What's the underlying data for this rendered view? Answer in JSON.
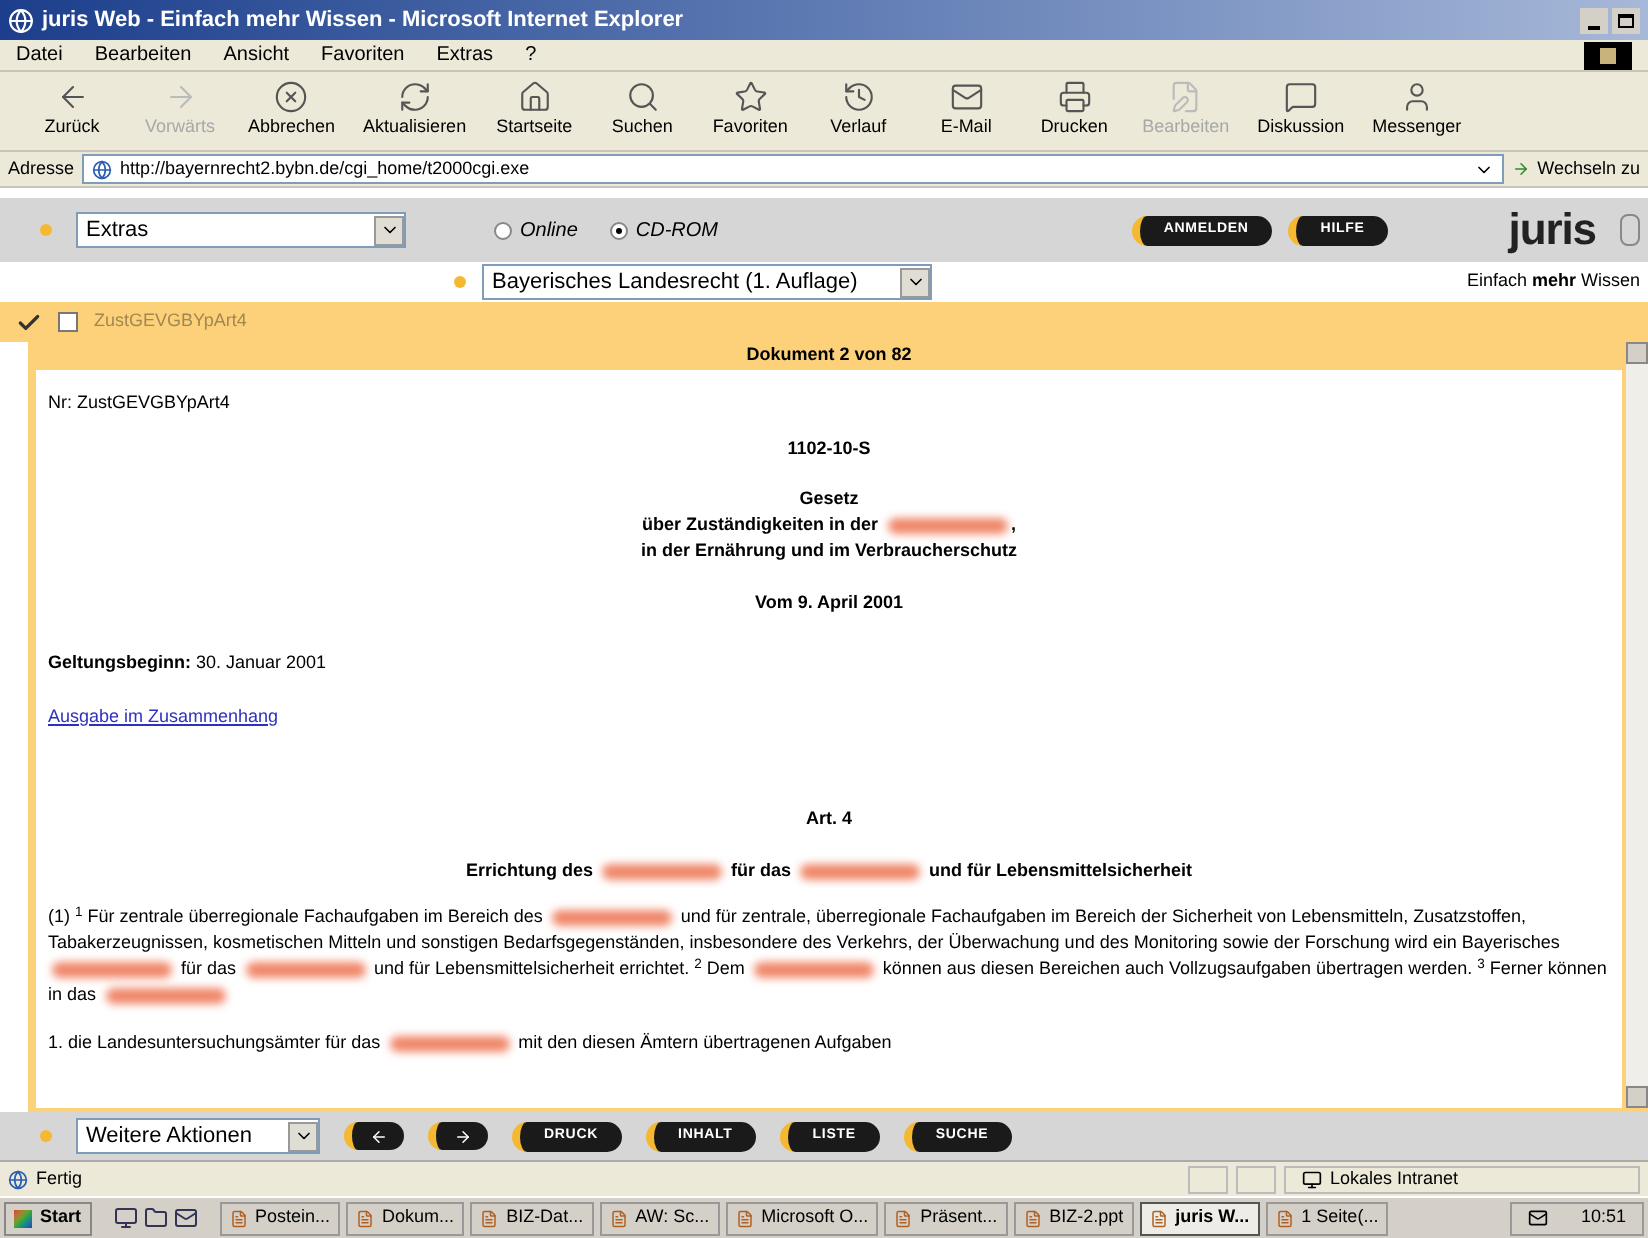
{
  "window": {
    "title": "juris Web - Einfach mehr Wissen - Microsoft Internet Explorer"
  },
  "menu": [
    "Datei",
    "Bearbeiten",
    "Ansicht",
    "Favoriten",
    "Extras",
    "?"
  ],
  "toolbar": [
    {
      "kind": "back",
      "label": "Zurück",
      "disabled": false
    },
    {
      "kind": "forward",
      "label": "Vorwärts",
      "disabled": true
    },
    {
      "kind": "stop",
      "label": "Abbrechen",
      "disabled": false
    },
    {
      "kind": "refresh",
      "label": "Aktualisieren",
      "disabled": false
    },
    {
      "kind": "home",
      "label": "Startseite",
      "disabled": false
    },
    {
      "kind": "search",
      "label": "Suchen",
      "disabled": false
    },
    {
      "kind": "favorites",
      "label": "Favoriten",
      "disabled": false
    },
    {
      "kind": "history",
      "label": "Verlauf",
      "disabled": false
    },
    {
      "kind": "mail",
      "label": "E-Mail",
      "disabled": false
    },
    {
      "kind": "print",
      "label": "Drucken",
      "disabled": false
    },
    {
      "kind": "edit",
      "label": "Bearbeiten",
      "disabled": true
    },
    {
      "kind": "discuss",
      "label": "Diskussion",
      "disabled": false
    },
    {
      "kind": "messenger",
      "label": "Messenger",
      "disabled": false
    }
  ],
  "address": {
    "label": "Adresse",
    "value": "http://bayernrecht2.bybn.de/cgi_home/t2000cgi.exe",
    "go": "Wechseln zu"
  },
  "app": {
    "extras_select": "Extras",
    "modes": [
      {
        "label": "Online",
        "selected": false
      },
      {
        "label": "CD-ROM",
        "selected": true
      }
    ],
    "header_buttons": [
      "ANMELDEN",
      "HILFE"
    ],
    "logo": "juris",
    "tagline": "Einfach **mehr** Wissen",
    "collection_select": "Bayerisches Landesrecht (1. Auflage)",
    "tree_item": {
      "label": "ZustGEVGBYpArt4",
      "checked": false
    }
  },
  "document": {
    "header": "Dokument 2 von 82",
    "nr": "Nr: ZustGEVGBYpArt4",
    "code": "1102-10-S",
    "title_lines": [
      [
        {
          "kind": "text",
          "text": "Gesetz"
        }
      ],
      [
        {
          "kind": "text",
          "text": "über Zuständigkeiten in der "
        },
        {
          "kind": "redacted"
        },
        {
          "kind": "text",
          "text": ","
        }
      ],
      [
        {
          "kind": "text",
          "text": "in der Ernährung und im Verbraucherschutz"
        }
      ]
    ],
    "date": "Vom 9. April 2001",
    "validity": "**Geltungsbeginn:** 30. Januar 2001",
    "link": "Ausgabe im Zusammenhang",
    "article": "Art. 4",
    "article_title": [
      {
        "kind": "text",
        "text": "Errichtung des "
      },
      {
        "kind": "redacted"
      },
      {
        "kind": "text",
        "text": " für das "
      },
      {
        "kind": "redacted"
      },
      {
        "kind": "text",
        "text": " und für Lebensmittelsicherheit"
      }
    ],
    "paragraph": [
      {
        "kind": "text",
        "text": "(1) $^{1}$ Für zentrale überregionale Fachaufgaben im Bereich des "
      },
      {
        "kind": "redacted"
      },
      {
        "kind": "text",
        "text": " und für zentrale, überregionale Fachaufgaben im Bereich der Sicherheit von Lebensmitteln, Zusatzstoffen, Tabakerzeugnissen, kosmetischen Mitteln und sonstigen Bedarfsgegenständen, insbesondere des Verkehrs, der Überwachung und des Monitoring sowie der Forschung wird ein Bayerisches "
      },
      {
        "kind": "redacted"
      },
      {
        "kind": "text",
        "text": " für das "
      },
      {
        "kind": "redacted"
      },
      {
        "kind": "text",
        "text": " und für Lebensmittelsicherheit errichtet. $^{2}$ Dem "
      },
      {
        "kind": "redacted"
      },
      {
        "kind": "text",
        "text": " können aus diesen Bereichen auch Vollzugsaufgaben übertragen werden. $^{3}$ Ferner können in das "
      },
      {
        "kind": "redacted"
      }
    ],
    "list_item": [
      {
        "kind": "text",
        "text": "1. die Landesuntersuchungsämter für das "
      },
      {
        "kind": "redacted"
      },
      {
        "kind": "text",
        "text": " mit den diesen Ämtern übertragenen Aufgaben"
      }
    ]
  },
  "footer": {
    "actions_select": "Weitere Aktionen",
    "buttons": [
      "DRUCK",
      "INHALT",
      "LISTE",
      "SUCHE"
    ]
  },
  "status_bar": {
    "text": "Fertig",
    "zone": "Lokales Intranet"
  },
  "taskbar": {
    "start": "Start",
    "tasks": [
      {
        "label": "Postein...",
        "selected": false
      },
      {
        "label": "Dokum...",
        "selected": false
      },
      {
        "label": "BIZ-Dat...",
        "selected": false
      },
      {
        "label": "AW: Sc...",
        "selected": false
      },
      {
        "label": "Microsoft O...",
        "selected": false
      },
      {
        "label": "Präsent...",
        "selected": false
      },
      {
        "label": "BIZ-2.ppt",
        "selected": false
      },
      {
        "label": "juris W...",
        "selected": true
      },
      {
        "label": "1 Seite(...",
        "selected": false
      }
    ],
    "clock": "10:51"
  }
}
